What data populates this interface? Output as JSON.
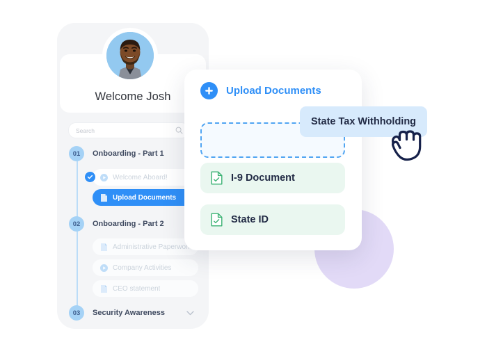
{
  "colors": {
    "accent_blue": "#2F8FF7",
    "light_blue": "#A5D2F6",
    "chip_blue": "#D7EAFC",
    "doc_green_bg": "#EAF7F0",
    "doc_green_icon": "#3BB273",
    "lavender": "#E2DAF7",
    "phone_shell": "#F4F5F7",
    "dark_text": "#222B45"
  },
  "phone": {
    "welcome_text": "Welcome Josh",
    "avatar_name": "avatar",
    "search": {
      "placeholder": "Search",
      "value": "",
      "icon": "search-icon"
    },
    "steps": [
      {
        "number": "01",
        "label": "Onboarding - Part 1",
        "expanded": true,
        "chevron": false,
        "items": [
          {
            "label": "Welcome Aboard!",
            "icon": "play-icon",
            "state": "completed",
            "checked": true
          },
          {
            "label": "Upload Documents",
            "icon": "file-icon",
            "state": "active",
            "checked": false
          }
        ]
      },
      {
        "number": "02",
        "label": "Onboarding - Part 2",
        "expanded": true,
        "chevron": false,
        "items": [
          {
            "label": "Administrative Paperwork",
            "icon": "file-icon",
            "state": "default",
            "checked": false
          },
          {
            "label": "Company Activities",
            "icon": "play-icon",
            "state": "default",
            "checked": false
          },
          {
            "label": "CEO statement",
            "icon": "file-icon",
            "state": "default",
            "checked": false
          }
        ]
      },
      {
        "number": "03",
        "label": "Security Awareness",
        "expanded": false,
        "chevron": true,
        "items": []
      }
    ]
  },
  "upload_card": {
    "title": "Upload Documents",
    "add_icon": "plus-circle-icon",
    "dropzone": {
      "name": "dropzone",
      "label": ""
    },
    "documents": [
      {
        "label": "I-9 Document",
        "icon": "file-check-icon"
      },
      {
        "label": "State ID",
        "icon": "file-check-icon"
      }
    ]
  },
  "drag": {
    "chip_label": "State Tax Withholding",
    "cursor_icon": "grab-hand-cursor"
  }
}
